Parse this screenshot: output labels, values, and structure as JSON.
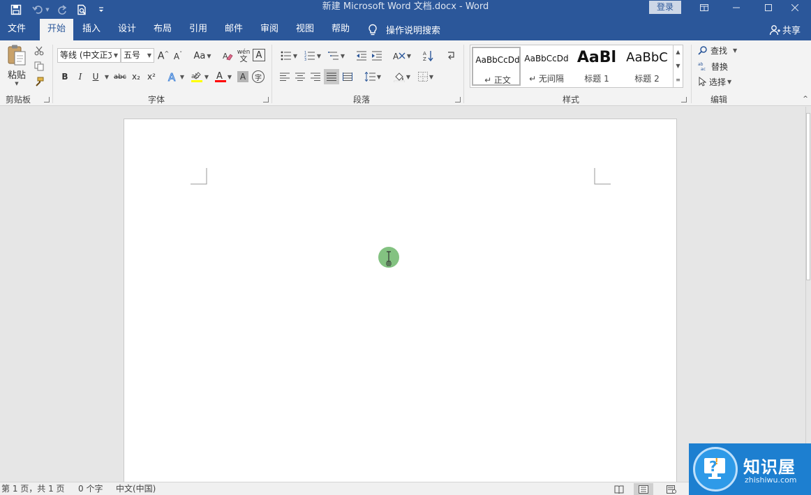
{
  "window": {
    "title": "新建 Microsoft Word 文档.docx  -  Word",
    "login_label": "登录"
  },
  "tabs": [
    {
      "label": "文件"
    },
    {
      "label": "开始"
    },
    {
      "label": "插入"
    },
    {
      "label": "设计"
    },
    {
      "label": "布局"
    },
    {
      "label": "引用"
    },
    {
      "label": "邮件"
    },
    {
      "label": "审阅"
    },
    {
      "label": "视图"
    },
    {
      "label": "帮助"
    }
  ],
  "tell_me": "操作说明搜索",
  "share_label": "共享",
  "clipboard": {
    "paste_label": "粘贴",
    "group_label": "剪贴板"
  },
  "font": {
    "family_value": "等线 (中文正文)",
    "size_value": "五号",
    "case_label": "Aa",
    "phonetic_label": "wén",
    "phonetic_char": "文",
    "bold": "B",
    "italic": "I",
    "underline": "U",
    "strike": "abc",
    "subscript": "x₂",
    "superscript": "x²",
    "enclose_char": "字",
    "group_label": "字体"
  },
  "paragraph": {
    "group_label": "段落"
  },
  "styles": {
    "group_label": "样式",
    "items": [
      {
        "preview": "AaBbCcDd",
        "name": "↵ 正文"
      },
      {
        "preview": "AaBbCcDd",
        "name": "↵ 无间隔"
      },
      {
        "preview": "AaBl",
        "name": "标题 1"
      },
      {
        "preview": "AaBbC",
        "name": "标题 2"
      }
    ]
  },
  "editing": {
    "find_label": "查找",
    "replace_label": "替换",
    "select_label": "选择",
    "group_label": "编辑"
  },
  "status": {
    "page": "第 1 页，共 1 页",
    "words": "0 个字",
    "language": "中文(中国)"
  },
  "watermark": {
    "name": "知识屋",
    "domain": "zhishiwu.com"
  },
  "colors": {
    "accent": "#2b579a",
    "highlight": "#ffff00",
    "font_color": "#ff0000",
    "cursor_dot": "#7cbf7a"
  }
}
